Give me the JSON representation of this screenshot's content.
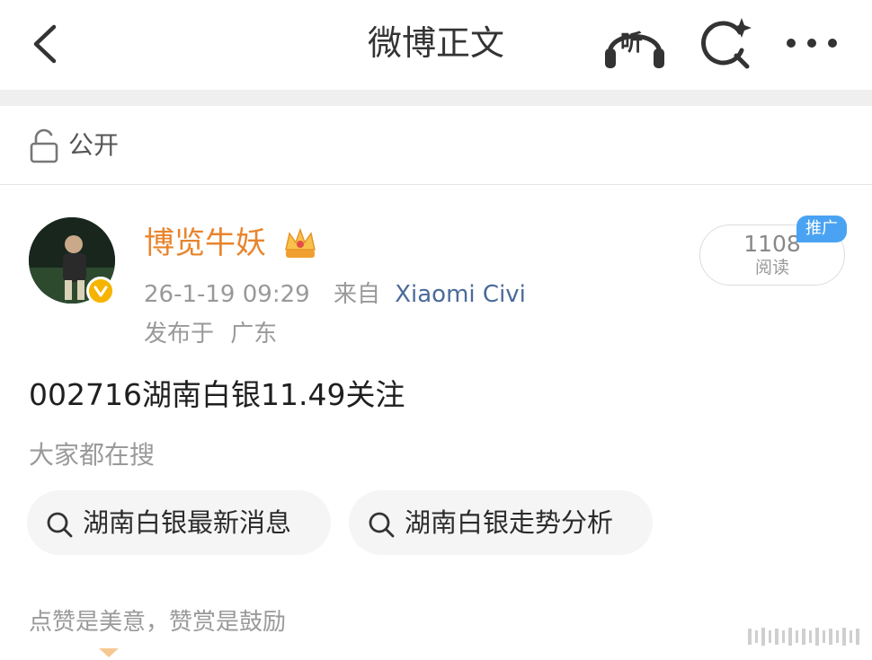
{
  "nav": {
    "title": "微博正文",
    "listen_label": "听"
  },
  "visibility": {
    "label": "公开"
  },
  "author": {
    "name": "博览牛妖",
    "time": "26-1-19 09:29",
    "from_label": "来自",
    "device": "Xiaomi Civi",
    "published_label": "发布于",
    "location": "广东"
  },
  "reads": {
    "count": "1108",
    "label": "阅读",
    "promo_tag": "推广"
  },
  "post": {
    "text": "002716湖南白银11.49关注"
  },
  "search": {
    "heading": "大家都在搜",
    "chips": [
      {
        "label": "湖南白银最新消息"
      },
      {
        "label": "湖南白银走势分析"
      }
    ]
  },
  "reward": {
    "text": "点赞是美意，赞赏是鼓励"
  },
  "colors": {
    "author_name": "#e8842d",
    "device_link": "#4a6a9a",
    "promo_blue": "#4aa3f2",
    "verified_gold": "#f6b400"
  },
  "icons": [
    "back-arrow-icon",
    "headphones-icon",
    "search-sparkle-icon",
    "more-dots-icon",
    "lock-open-icon",
    "crown-icon",
    "verified-badge-icon",
    "search-icon"
  ]
}
